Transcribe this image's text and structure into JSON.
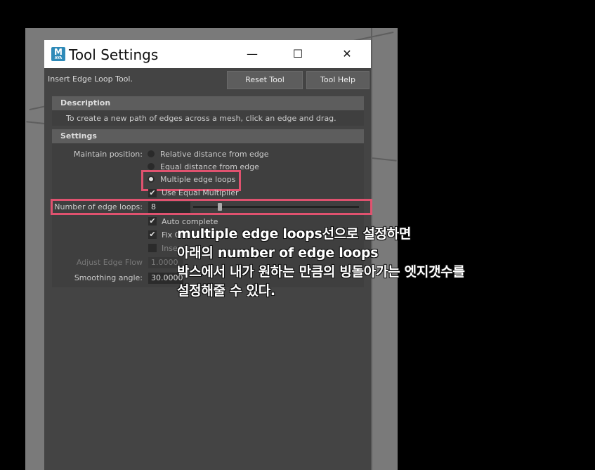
{
  "window": {
    "title": "Tool Settings",
    "app_icon_letter": "M",
    "app_icon_sub": "AYA",
    "minimize": "—",
    "maximize": "☐",
    "close": "✕"
  },
  "toolbar": {
    "tool_name": "Insert Edge Loop Tool.",
    "reset_label": "Reset Tool",
    "help_label": "Tool Help"
  },
  "description": {
    "header": "Description",
    "text": "To create a new path of edges across a mesh, click an edge and drag."
  },
  "settings": {
    "header": "Settings",
    "maintain_position_label": "Maintain position:",
    "options": [
      {
        "label": "Relative distance from edge",
        "selected": false
      },
      {
        "label": "Equal distance from edge",
        "selected": false
      },
      {
        "label": "Multiple edge loops",
        "selected": true
      }
    ],
    "use_equal_multiplier": "Use Equal Multiplier",
    "num_loops_label": "Number of edge loops:",
    "num_loops_value": "8",
    "num_loops_slider_fraction": 0.15,
    "auto_complete": "Auto complete",
    "fix_label": "Fix C",
    "insert_label": "Inse",
    "adjust_edge_flow_label": "Adjust Edge Flow",
    "adjust_edge_flow_value": "1.0000",
    "smoothing_angle_label": "Smoothing angle:",
    "smoothing_angle_value": "30.0000"
  },
  "annotation": {
    "text": "multiple edge loops선으로 설정하면\n아래의 number of edge loops\n박스에서 내가 원하는 만큼의 빙돌아가는 엣지갯수를\n설정해줄 수 있다."
  },
  "colors": {
    "highlight": "#e0526f",
    "dialog_bg": "#444444",
    "app_icon": "#2e8ab8"
  }
}
